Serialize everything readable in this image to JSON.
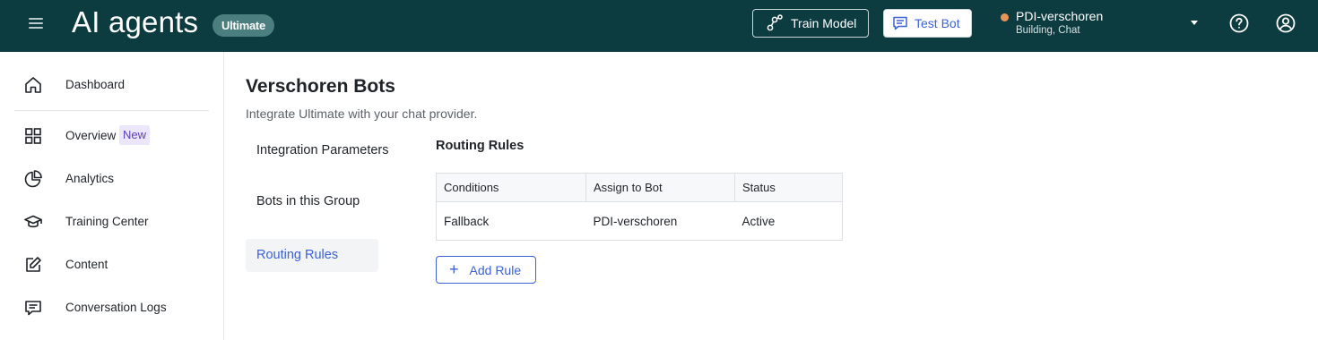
{
  "header": {
    "app_title": "AI agents",
    "plan_badge": "Ultimate",
    "train_model_label": "Train Model",
    "test_bot_label": "Test Bot",
    "bot_selector": {
      "name": "PDI-verschoren",
      "subtitle": "Building, Chat",
      "status_color": "#e8935a"
    },
    "help_icon": "help-circle-icon",
    "account_icon": "account-circle-icon"
  },
  "sidebar": {
    "items": [
      {
        "label": "Dashboard",
        "icon": "home-icon"
      },
      {
        "label": "Overview",
        "icon": "grid-icon",
        "badge": "New"
      },
      {
        "label": "Analytics",
        "icon": "pie-chart-icon"
      },
      {
        "label": "Training Center",
        "icon": "graduation-cap-icon"
      },
      {
        "label": "Content",
        "icon": "edit-icon"
      },
      {
        "label": "Conversation Logs",
        "icon": "chat-log-icon"
      }
    ]
  },
  "main": {
    "title": "Verschoren Bots",
    "subtitle": "Integrate Ultimate with your chat provider.",
    "subnav": [
      {
        "label": "Integration Parameters",
        "active": false
      },
      {
        "label": "Bots in this Group",
        "active": false
      },
      {
        "label": "Routing Rules",
        "active": true
      }
    ],
    "routing_rules": {
      "title": "Routing Rules",
      "columns": [
        "Conditions",
        "Assign to Bot",
        "Status"
      ],
      "rows": [
        [
          "Fallback",
          "PDI-verschoren",
          "Active"
        ]
      ],
      "add_rule_label": "Add Rule"
    }
  },
  "colors": {
    "topbar_bg": "#0c3b40",
    "accent": "#3b62d6",
    "badge_bg": "#4a7e7f"
  }
}
